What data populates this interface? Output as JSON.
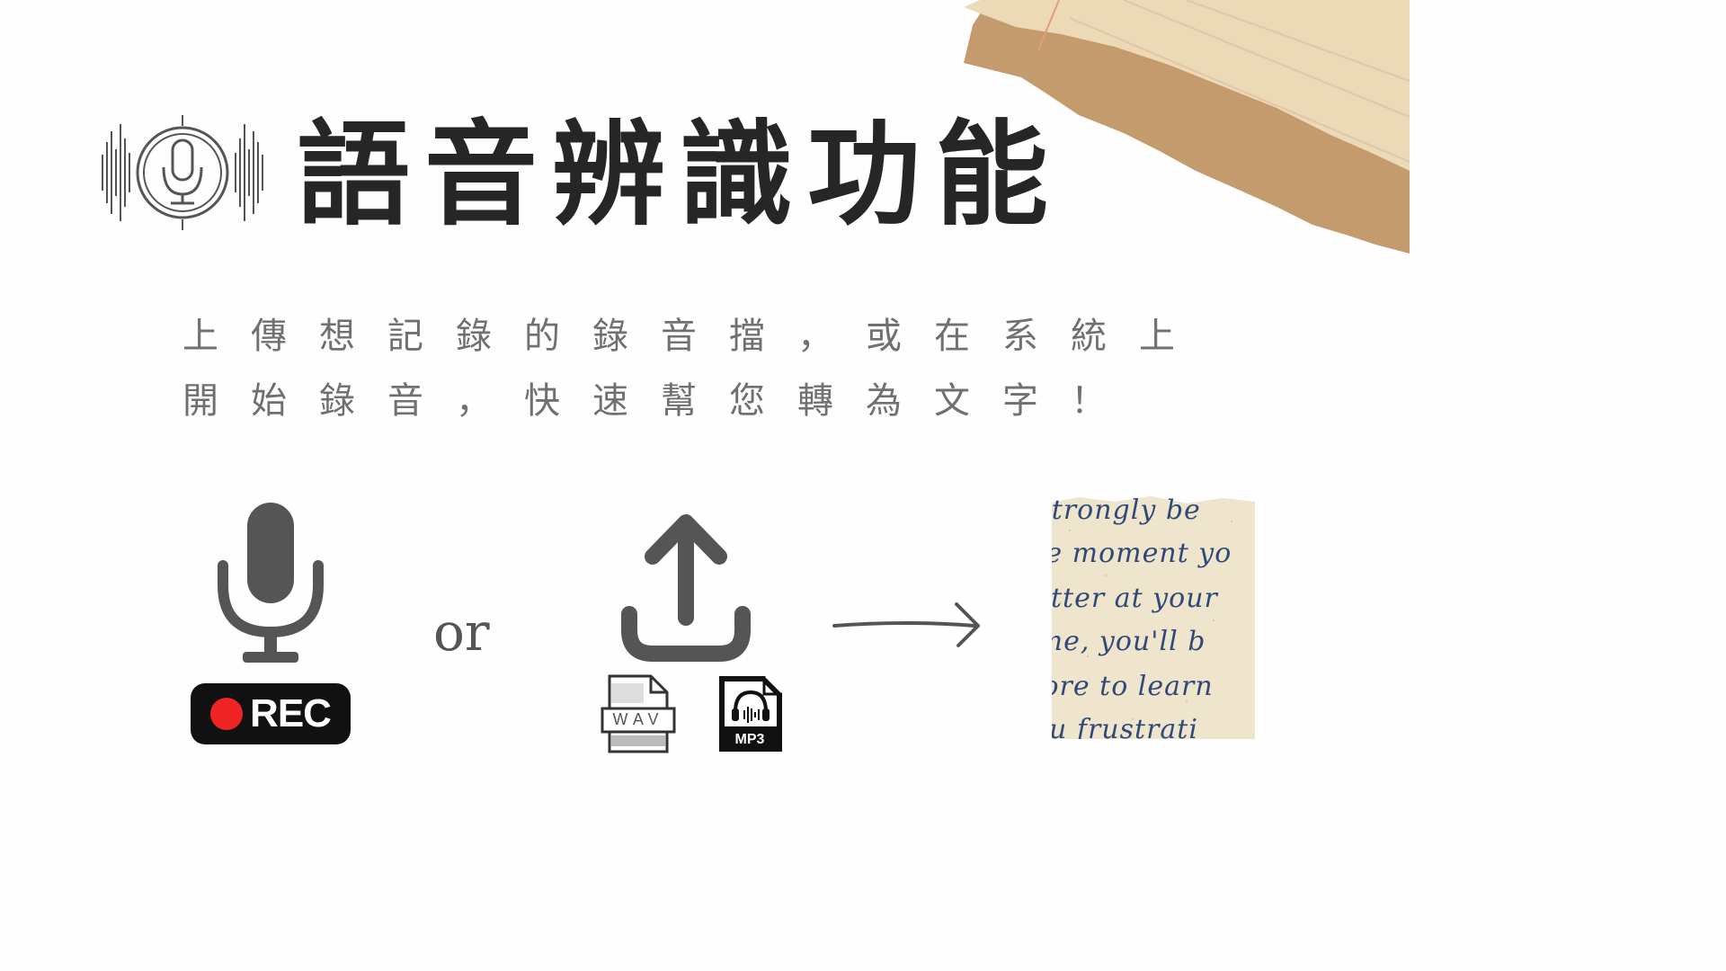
{
  "header": {
    "title": "語音辨識功能",
    "logo_icon": "waveform-microphone-icon"
  },
  "description": {
    "line1": "上傳想記錄的錄音擋，或在系統上",
    "line2": "開始錄音，快速幫您轉為文字！"
  },
  "workflow": {
    "record": {
      "icon": "microphone-icon",
      "badge_label": "REC"
    },
    "connector_text": "or",
    "upload": {
      "icon": "upload-icon",
      "file_types": [
        {
          "icon": "wav-file-icon",
          "label": "WAV"
        },
        {
          "icon": "mp3-file-icon",
          "label": "MP3"
        }
      ]
    },
    "arrow_icon": "arrow-right-icon",
    "result": {
      "icon": "handwritten-note-image",
      "lines": [
        "I strongly be",
        "the moment yo",
        "better at your",
        "time, you'll b",
        "more to learn",
        "you frustrati"
      ]
    }
  },
  "colors": {
    "title": "#262626",
    "text_gray": "#707070",
    "icon_gray": "#555555",
    "rec_badge": "#111111",
    "rec_dot": "#ef2323",
    "paper_light": "#ecd9b6",
    "paper_dark": "#c49b6c",
    "ink": "#2f4a7a"
  }
}
